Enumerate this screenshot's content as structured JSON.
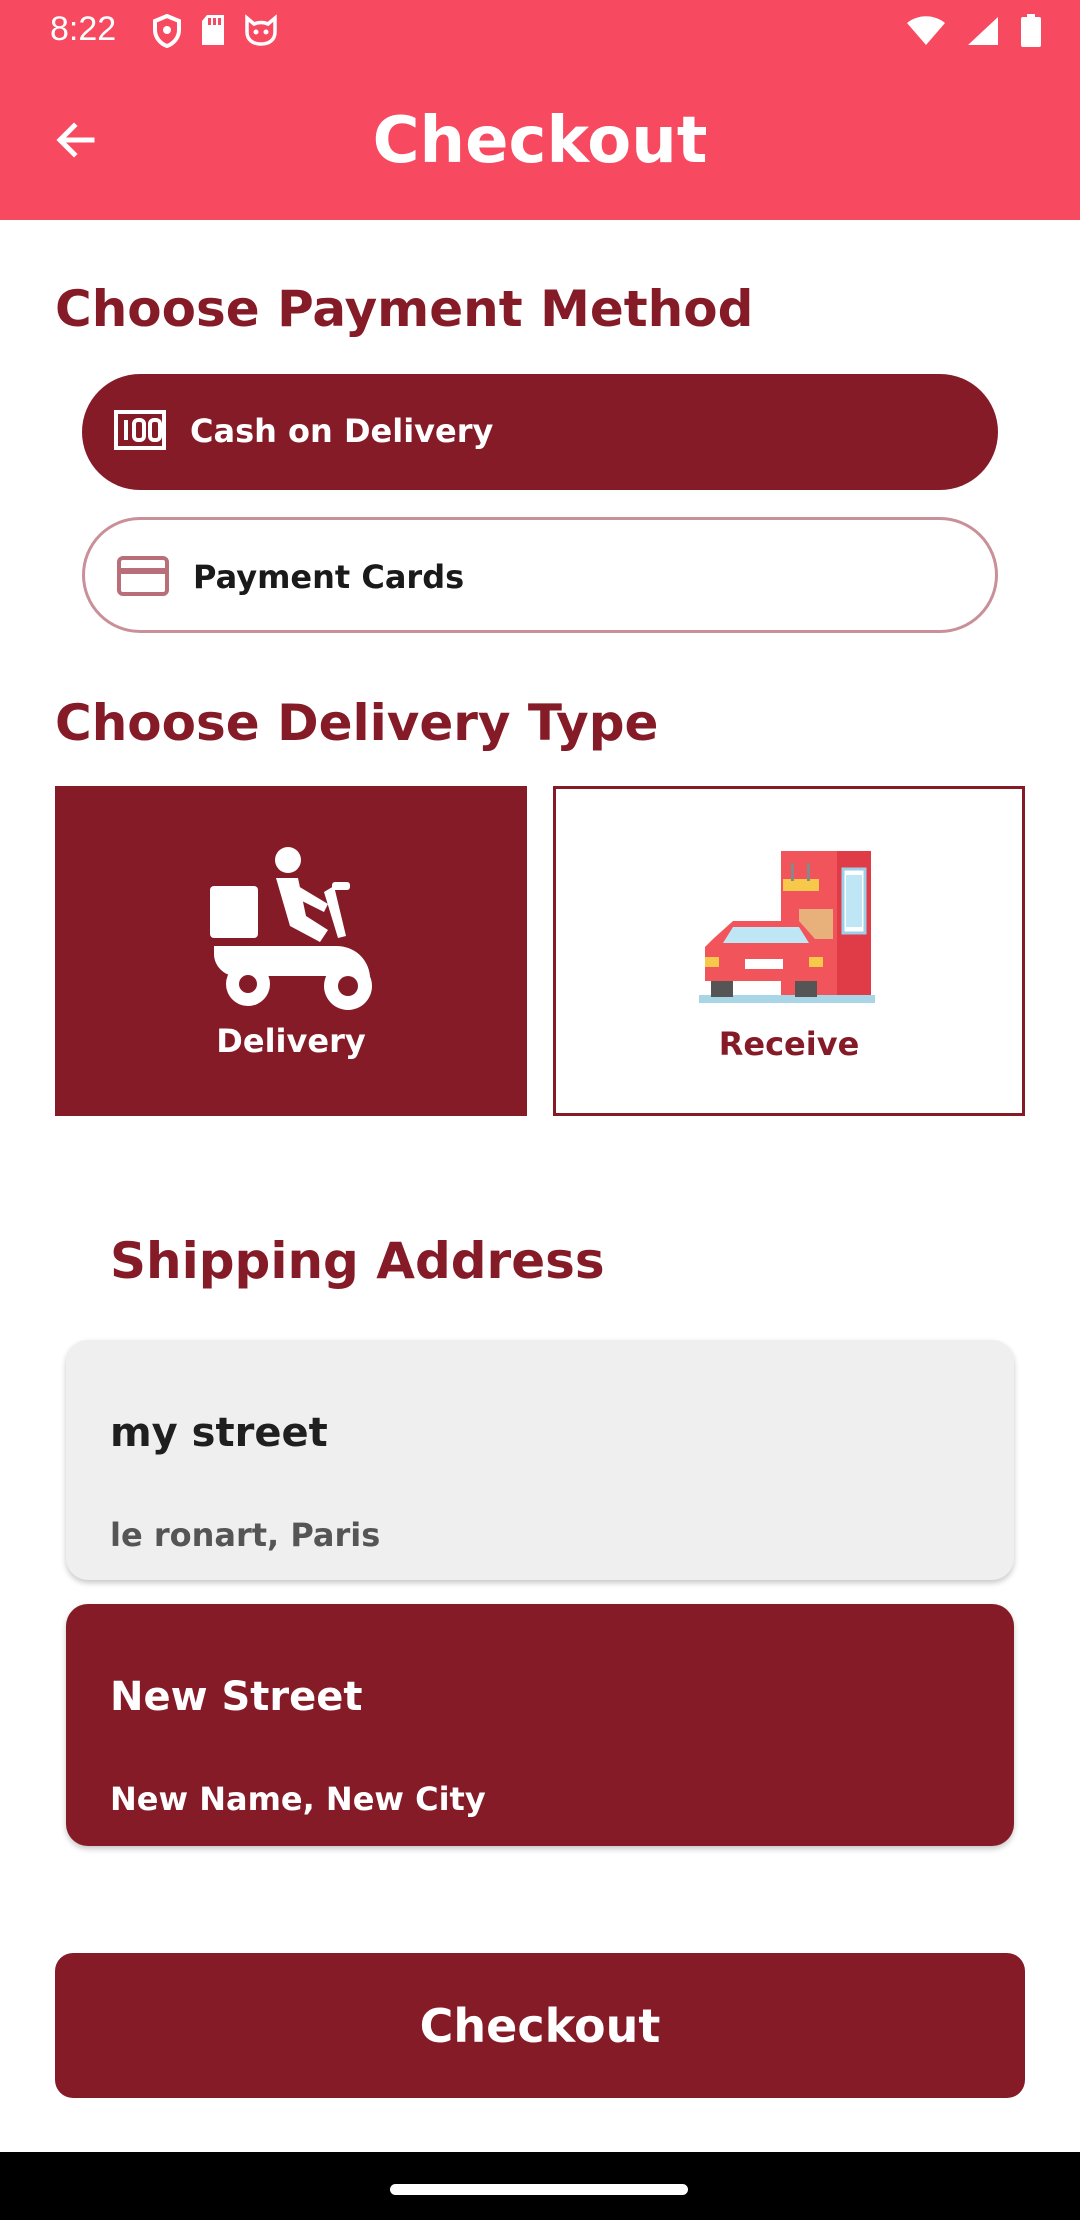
{
  "status_bar": {
    "time": "8:22",
    "icons": [
      "shield-icon",
      "sd-card-icon",
      "cat-face-icon",
      "wifi-icon",
      "signal-icon",
      "battery-icon"
    ]
  },
  "app_bar": {
    "title": "Checkout",
    "back_icon": "arrow-left-icon"
  },
  "payment": {
    "title": "Choose Payment Method",
    "options": [
      {
        "label": "Cash on Delivery",
        "icon": "cash-icon",
        "selected": true
      },
      {
        "label": "Payment Cards",
        "icon": "credit-card-icon",
        "selected": false
      }
    ]
  },
  "delivery": {
    "title": "Choose Delivery Type",
    "options": [
      {
        "label": "Delivery",
        "icon": "delivery-scooter-icon",
        "selected": true
      },
      {
        "label": "Receive",
        "icon": "drive-through-icon",
        "selected": false
      }
    ]
  },
  "shipping": {
    "title": "Shipping Address",
    "addresses": [
      {
        "street": "my street",
        "city": "le ronart, Paris",
        "selected": false
      },
      {
        "street": "New Street",
        "city": "New Name, New City",
        "selected": true
      }
    ]
  },
  "checkout_button": {
    "label": "Checkout"
  },
  "colors": {
    "primary": "#f74a60",
    "accent": "#861b28",
    "card_bg": "#efefef"
  }
}
